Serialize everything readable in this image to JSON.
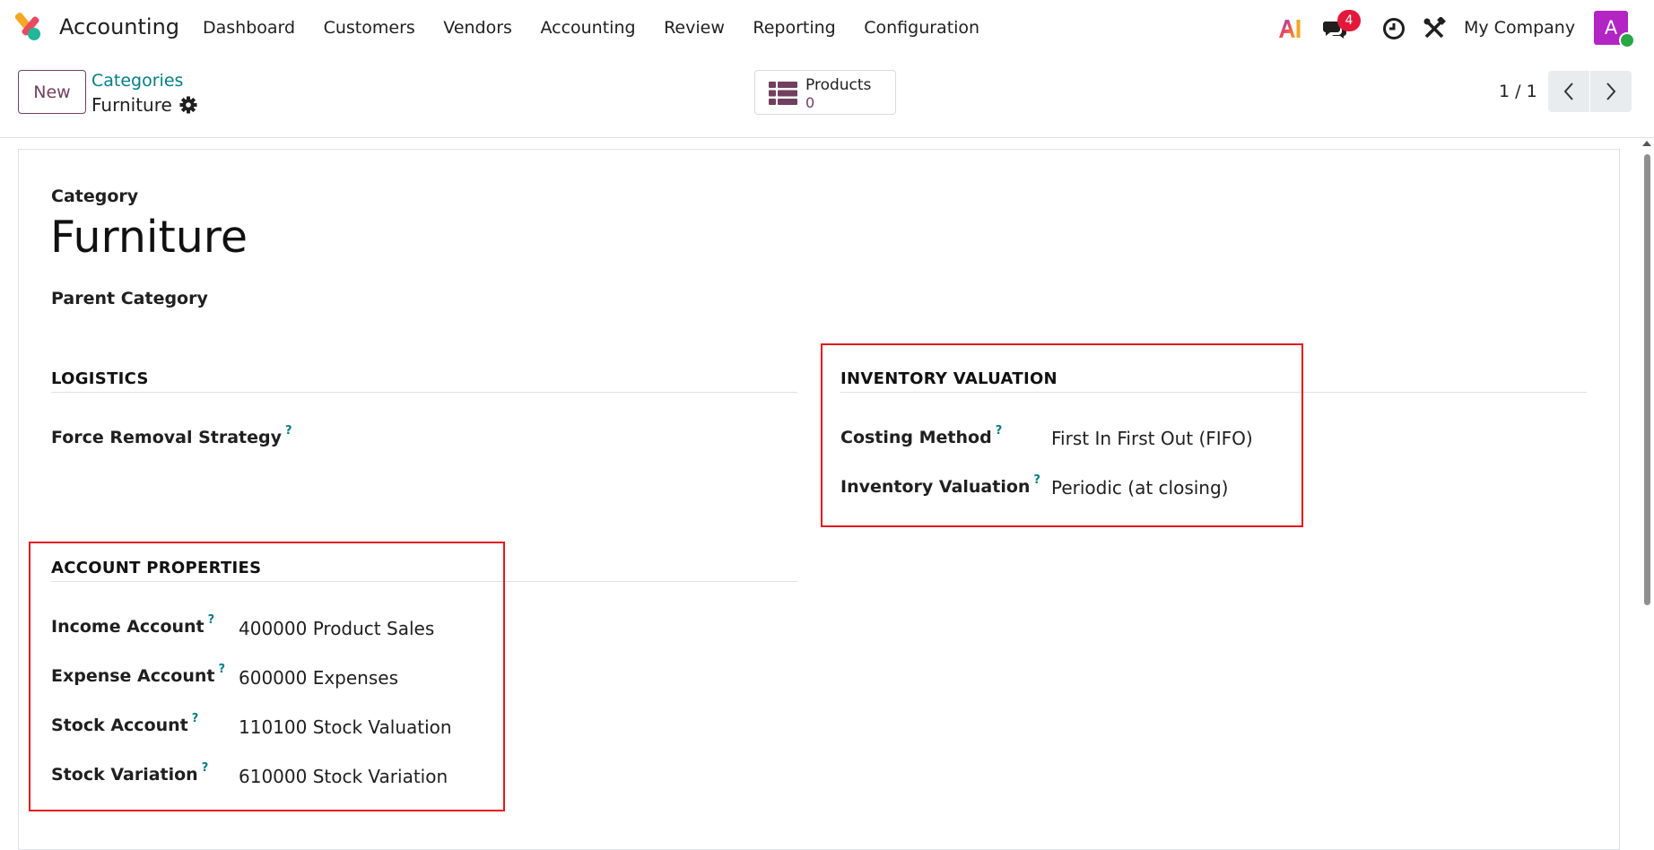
{
  "navbar": {
    "app_name": "Accounting",
    "menu": [
      "Dashboard",
      "Customers",
      "Vendors",
      "Accounting",
      "Review",
      "Reporting",
      "Configuration"
    ],
    "ai_label": "AI",
    "messages_badge": "4",
    "company": "My Company",
    "avatar_initial": "A",
    "icons": [
      "app-logo-icon",
      "ai-icon",
      "chat-icon",
      "clock-icon",
      "tools-icon"
    ]
  },
  "control": {
    "new_label": "New",
    "breadcrumb_parent": "Categories",
    "breadcrumb_current": "Furniture",
    "smart_button": {
      "label": "Products",
      "value": "0"
    },
    "pager": "1 / 1"
  },
  "form": {
    "category_label": "Category",
    "title": "Furniture",
    "parent_label": "Parent Category",
    "logistics": {
      "title": "LOGISTICS",
      "fields": [
        {
          "label": "Force Removal Strategy",
          "help": "?"
        }
      ]
    },
    "inventory": {
      "title": "INVENTORY VALUATION",
      "fields": [
        {
          "label": "Costing Method",
          "help": "?",
          "value": "First In First Out (FIFO)"
        },
        {
          "label": "Inventory Valuation",
          "help": "?",
          "value": "Periodic (at closing)"
        }
      ]
    },
    "accounts": {
      "title": "ACCOUNT PROPERTIES",
      "fields": [
        {
          "label": "Income Account",
          "help": "?",
          "value": "400000 Product Sales"
        },
        {
          "label": "Expense Account",
          "help": "?",
          "value": "600000 Expenses"
        },
        {
          "label": "Stock Account",
          "help": "?",
          "value": "110100 Stock Valuation"
        },
        {
          "label": "Stock Variation",
          "help": "?",
          "value": "610000 Stock Variation"
        }
      ]
    }
  },
  "colors": {
    "brand": "#71405f",
    "link": "#017e84",
    "highlight": "#e5151c",
    "badge": "#e3193b",
    "avatar": "#b224c4"
  }
}
